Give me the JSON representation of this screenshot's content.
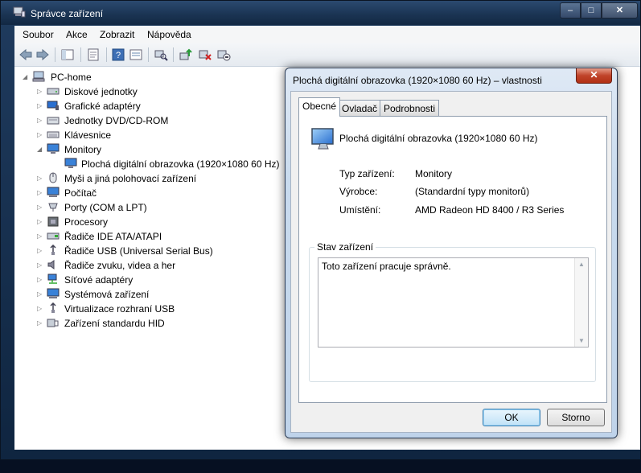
{
  "window": {
    "title": "Správce zařízení",
    "controls": {
      "minimize": "‒",
      "maximize": "□",
      "close": "✕"
    }
  },
  "menu": [
    "Soubor",
    "Akce",
    "Zobrazit",
    "Nápověda"
  ],
  "toolbar": [
    "back-icon",
    "forward-icon",
    "show-hide-console-tree-icon",
    "properties-icon",
    "help-icon",
    "view-icon",
    "scan-hardware-icon",
    "update-driver-icon",
    "uninstall-icon",
    "disable-icon"
  ],
  "tree": {
    "root": "PC-home",
    "items": [
      {
        "label": "Diskové jednotky",
        "icon": "disk-icon",
        "expanded": false
      },
      {
        "label": "Grafické adaptéry",
        "icon": "display-adapter-icon",
        "expanded": false
      },
      {
        "label": "Jednotky DVD/CD-ROM",
        "icon": "dvd-icon",
        "expanded": false
      },
      {
        "label": "Klávesnice",
        "icon": "keyboard-icon",
        "expanded": false
      },
      {
        "label": "Monitory",
        "icon": "monitor-icon",
        "expanded": true
      },
      {
        "label": "Plochá digitální obrazovka (1920×1080 60 Hz)",
        "icon": "monitor-icon",
        "child": true
      },
      {
        "label": "Myši a jiná polohovací zařízení",
        "icon": "mouse-icon",
        "expanded": false
      },
      {
        "label": "Počítač",
        "icon": "computer-icon",
        "expanded": false
      },
      {
        "label": "Porty (COM a LPT)",
        "icon": "port-icon",
        "expanded": false
      },
      {
        "label": "Procesory",
        "icon": "processor-icon",
        "expanded": false
      },
      {
        "label": "Řadiče IDE ATA/ATAPI",
        "icon": "ide-controller-icon",
        "expanded": false
      },
      {
        "label": "Řadiče USB (Universal Serial Bus)",
        "icon": "usb-icon",
        "expanded": false
      },
      {
        "label": "Řadiče zvuku, videa a her",
        "icon": "speaker-icon",
        "expanded": false
      },
      {
        "label": "Síťové adaptéry",
        "icon": "network-icon",
        "expanded": false
      },
      {
        "label": "Systémová zařízení",
        "icon": "system-device-icon",
        "expanded": false
      },
      {
        "label": "Virtualizace rozhraní USB",
        "icon": "usb-icon",
        "expanded": false
      },
      {
        "label": "Zařízení standardu HID",
        "icon": "hid-icon",
        "expanded": false
      }
    ]
  },
  "dialog": {
    "title": "Plochá digitální obrazovka (1920×1080 60 Hz) – vlastnosti",
    "close": "✕",
    "tabs": [
      "Obecné",
      "Ovladač",
      "Podrobnosti"
    ],
    "active_tab": "Obecné",
    "device_name": "Plochá digitální obrazovka (1920×1080 60 Hz)",
    "props": [
      {
        "label": "Typ zařízení:",
        "value": "Monitory"
      },
      {
        "label": "Výrobce:",
        "value": "(Standardní typy monitorů)"
      },
      {
        "label": "Umístění:",
        "value": "AMD Radeon HD 8400 / R3 Series"
      }
    ],
    "status_group": "Stav zařízení",
    "status_text": "Toto zařízení pracuje správně.",
    "ok": "OK",
    "cancel": "Storno"
  }
}
